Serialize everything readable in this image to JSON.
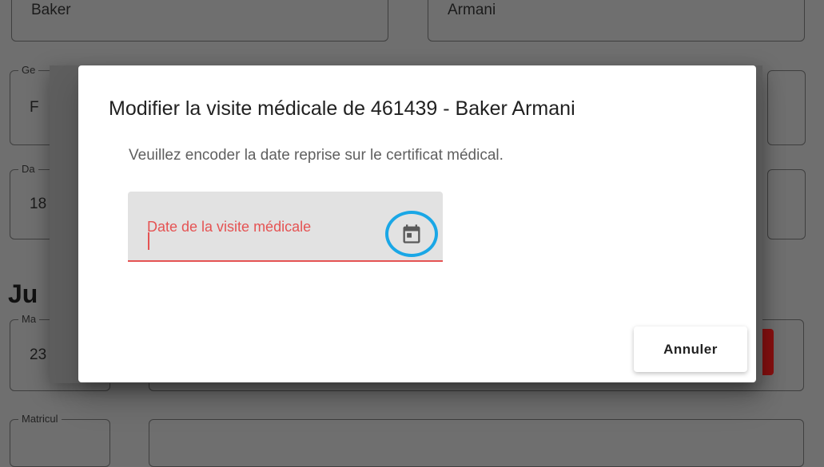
{
  "background": {
    "top_left_value": "Baker",
    "top_right_value": "Armani",
    "gender_label": "Ge",
    "gender_value": "F",
    "date_label": "Da",
    "date_value": "18",
    "section_heading": "Ju",
    "matricule_short_label": "Ma",
    "matricule_short_value": "23",
    "matricule_label": "Matricul"
  },
  "dialog": {
    "title": "Modifier la visite médicale de 461439 - Baker Armani",
    "subtitle": "Veuillez encoder la date reprise sur le certificat médical.",
    "date_field": {
      "label": "Date de la visite médicale",
      "value": "",
      "icon": "calendar-icon",
      "error_color": "#e55353",
      "highlight_color": "#1aa7e6"
    },
    "cancel_button": "Annuler"
  }
}
